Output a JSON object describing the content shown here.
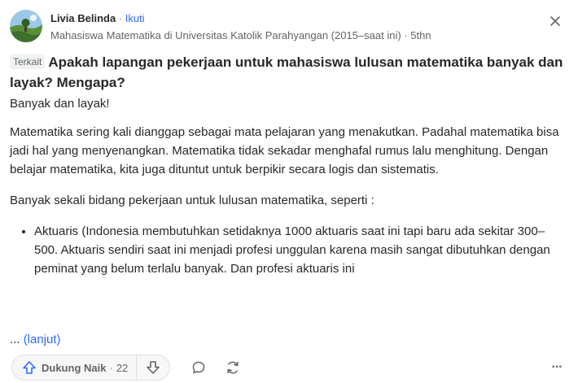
{
  "author": {
    "name": "Livia Belinda",
    "separator": "·",
    "follow_label": "Ikuti",
    "credential": "Mahasiswa Matematika di Universitas Katolik Parahyangan (2015–saat ini)",
    "time": "5thn"
  },
  "question": {
    "tag": "Terkait",
    "title": "Apakah lapangan pekerjaan untuk mahasiswa lulusan matematika banyak dan layak? Mengapa?"
  },
  "answer": {
    "paragraphs": [
      "Banyak dan layak!",
      "Matematika sering kali dianggap sebagai mata pelajaran yang menakutkan. Padahal matematika bisa jadi hal yang menyenangkan. Matematika tidak sekadar menghafal rumus lalu menghitung. Dengan belajar matematika, kita juga dituntut untuk berpikir secara logis dan sistematis.",
      "Banyak sekali bidang pekerjaan untuk lulusan matematika, seperti :"
    ],
    "bullets": [
      "Aktuaris (Indonesia membutuhkan setidaknya 1000 aktuaris saat ini tapi baru ada sekitar 300–500. Aktuaris sendiri saat ini menjadi profesi unggulan karena masih sangat dibutuhkan dengan peminat yang belum terlalu banyak. Dan profesi aktuaris ini"
    ],
    "more_ellipsis": "...",
    "more_label": "(lanjut)"
  },
  "actions": {
    "upvote_label": "Dukung Naik",
    "upvote_sep": "·",
    "upvote_count": "22",
    "overflow": "···"
  },
  "colors": {
    "link": "#2e69ff",
    "text": "#282829",
    "muted": "#636466",
    "upvote_icon": "#2e69ff"
  },
  "icons": [
    "close-icon",
    "upvote-arrow-icon",
    "downvote-arrow-icon",
    "comment-icon",
    "share-icon",
    "more-icon"
  ]
}
